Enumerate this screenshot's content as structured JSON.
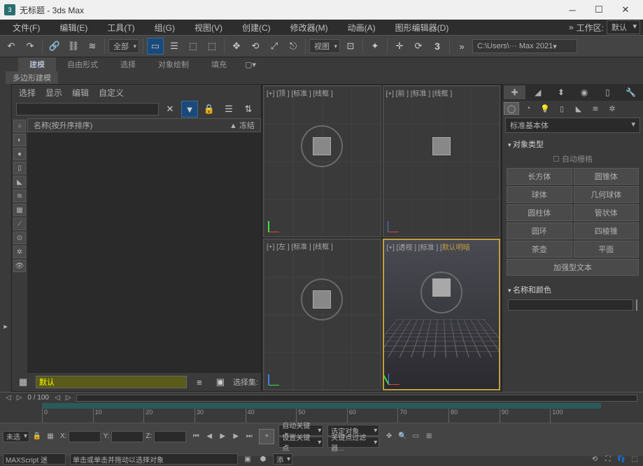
{
  "titlebar": {
    "title": "无标题 - 3ds Max"
  },
  "menubar": {
    "items": [
      "文件(F)",
      "编辑(E)",
      "工具(T)",
      "组(G)",
      "视图(V)",
      "创建(C)",
      "修改器(M)",
      "动画(A)",
      "图形编辑器(D)"
    ],
    "workspace_label": "工作区:",
    "workspace_value": "默认"
  },
  "toolbar": {
    "scope": "全部",
    "view_mode": "视图",
    "path": "C:\\Users\\··· Max 2021"
  },
  "tabs": {
    "ribbon": [
      "建模",
      "自由形式",
      "选择",
      "对象绘制",
      "填充"
    ],
    "sub": "多边形建模"
  },
  "scene": {
    "header": [
      "选择",
      "显示",
      "编辑",
      "自定义"
    ],
    "list_name": "名称(按升序排序)",
    "list_freeze": "▲ 冻结",
    "footer_set": "默认",
    "footer_label": "选择集:"
  },
  "viewports": {
    "top": "[+] [顶 ] [标准 ] [线框 ]",
    "front": "[+] [前 ] [标准 ] [线框 ]",
    "left": "[+] [左 ] [标准 ] [线框 ]",
    "persp_a": "[+] [透视 ] [标准 ] [",
    "persp_b": "默认明暗"
  },
  "cmd": {
    "dropdown": "标准基本体",
    "roll_type": "对象类型",
    "autogrid": "自动栅格",
    "buttons": [
      "长方体",
      "圆锥体",
      "球体",
      "几何球体",
      "圆柱体",
      "管状体",
      "圆环",
      "四棱锥",
      "茶壶",
      "平面"
    ],
    "buttons_wide": "加强型文本",
    "roll_name": "名称和颜色"
  },
  "timeline": {
    "frame": "0 / 100",
    "ticks": [
      "0",
      "10",
      "20",
      "30",
      "40",
      "50",
      "60",
      "70",
      "80",
      "90",
      "100"
    ]
  },
  "status": {
    "none": "未选",
    "x": "X:",
    "y": "Y:",
    "z": "Z:",
    "autokey": "自动关键点",
    "selobj": "选定对象",
    "setkey": "设置关键点",
    "keyfilter": "关键点过滤器...",
    "maxscript": "MAXScript 迷",
    "hint": "单击或单击并拖动以选择对象",
    "add": "添"
  }
}
